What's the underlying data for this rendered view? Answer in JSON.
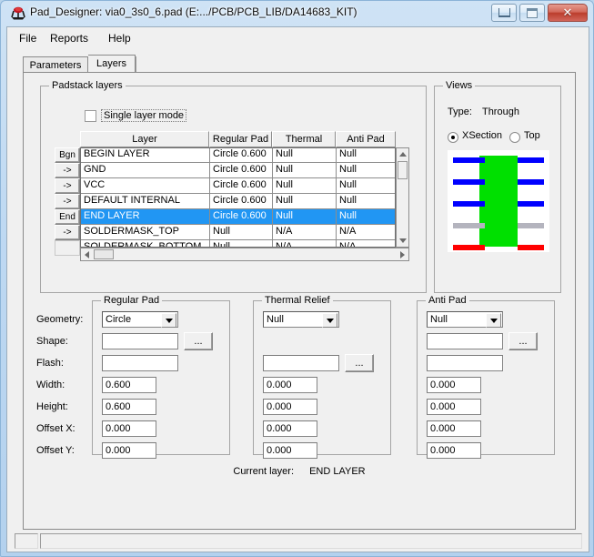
{
  "window": {
    "title": "Pad_Designer: via0_3s0_6.pad (E:.../PCB/PCB_LIB/DA14683_KIT)",
    "icon": "pad-designer-icon",
    "minimize_label": "Minimize",
    "maximize_label": "Maximize",
    "close_label": "✕"
  },
  "menubar": {
    "items": [
      {
        "label": "File"
      },
      {
        "label": "Reports"
      },
      {
        "label": "Help"
      }
    ]
  },
  "tabs": [
    {
      "label": "Parameters",
      "active": false
    },
    {
      "label": "Layers",
      "active": true
    }
  ],
  "padstack": {
    "group_label": "Padstack layers",
    "single_layer_mode": {
      "label": "Single layer mode",
      "checked": false
    },
    "columns": [
      "Layer",
      "Regular Pad",
      "Thermal Relief",
      "Anti Pad"
    ],
    "rows": [
      {
        "button": "Bgn",
        "layer": "BEGIN LAYER",
        "regular_pad": "Circle 0.600",
        "thermal_relief": "Null",
        "anti_pad": "Null",
        "selected": false
      },
      {
        "button": "->",
        "layer": "GND",
        "regular_pad": "Circle 0.600",
        "thermal_relief": "Null",
        "anti_pad": "Null",
        "selected": false
      },
      {
        "button": "->",
        "layer": "VCC",
        "regular_pad": "Circle 0.600",
        "thermal_relief": "Null",
        "anti_pad": "Null",
        "selected": false
      },
      {
        "button": "->",
        "layer": "DEFAULT INTERNAL",
        "regular_pad": "Circle 0.600",
        "thermal_relief": "Null",
        "anti_pad": "Null",
        "selected": false
      },
      {
        "button": "End",
        "layer": "END LAYER",
        "regular_pad": "Circle 0.600",
        "thermal_relief": "Null",
        "anti_pad": "Null",
        "selected": true
      },
      {
        "button": "->",
        "layer": "SOLDERMASK_TOP",
        "regular_pad": "Null",
        "thermal_relief": "N/A",
        "anti_pad": "N/A",
        "selected": false
      },
      {
        "button": "",
        "layer": "SOLDERMASK_BOTTOM",
        "regular_pad": "Null",
        "thermal_relief": "N/A",
        "anti_pad": "N/A",
        "selected": false
      }
    ]
  },
  "views": {
    "group_label": "Views",
    "type_label": "Type:",
    "type_value": "Through",
    "radios": [
      {
        "label": "XSection",
        "selected": true
      },
      {
        "label": "Top",
        "selected": false
      }
    ],
    "xsection": {
      "via_color": "#00e000",
      "layers": [
        {
          "color": "#0000ff"
        },
        {
          "color": "#0000ff"
        },
        {
          "color": "#0000ff"
        },
        {
          "color": "#b4b4be"
        },
        {
          "color": "#ff0000"
        }
      ]
    }
  },
  "field_labels": [
    "Geometry:",
    "Shape:",
    "Flash:",
    "Width:",
    "Height:",
    "Offset X:",
    "Offset Y:"
  ],
  "browse_button_label": "...",
  "regular_pad": {
    "group_label": "Regular Pad",
    "geometry": "Circle",
    "shape": "",
    "flash": "",
    "width": "0.600",
    "height": "0.600",
    "offset_x": "0.000",
    "offset_y": "0.000"
  },
  "thermal_relief": {
    "group_label": "Thermal Relief",
    "geometry": "Null",
    "shape": "",
    "width": "0.000",
    "height": "0.000",
    "offset_x": "0.000",
    "offset_y": "0.000"
  },
  "anti_pad": {
    "group_label": "Anti Pad",
    "geometry": "Null",
    "shape": "",
    "flash": "",
    "width": "0.000",
    "height": "0.000",
    "offset_x": "0.000",
    "offset_y": "0.000"
  },
  "current_layer": {
    "label": "Current layer:",
    "value": "END LAYER"
  },
  "statusbar": {
    "left": "",
    "main": ""
  }
}
